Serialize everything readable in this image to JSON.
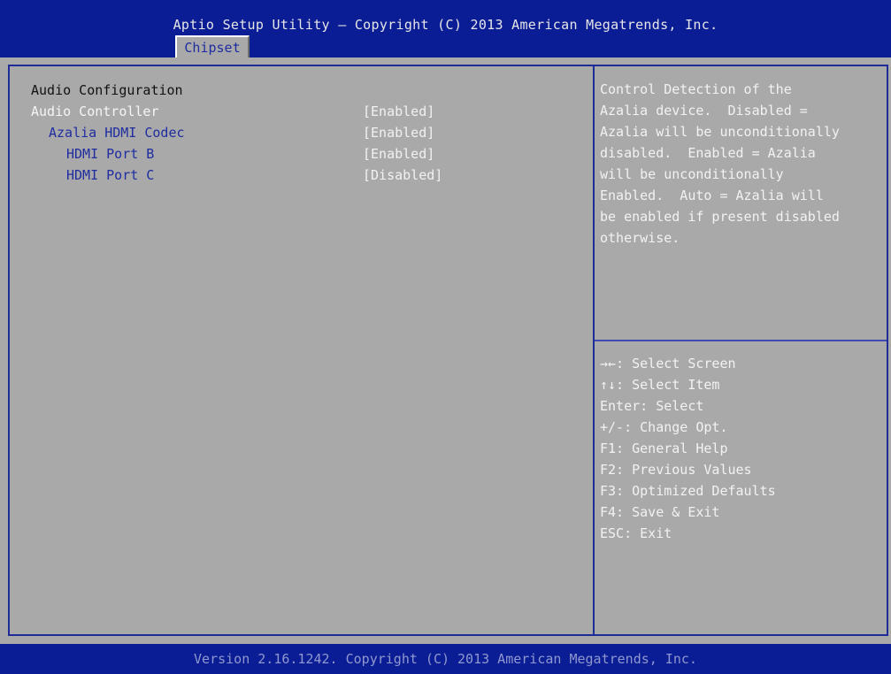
{
  "header": {
    "title": "Aptio Setup Utility – Copyright (C) 2013 American Megatrends, Inc.",
    "active_tab": "Chipset"
  },
  "main": {
    "section_title": "Audio Configuration",
    "items": [
      {
        "label": "Audio Controller",
        "value": "[Enabled]"
      },
      {
        "label": "Azalia HDMI Codec",
        "value": "[Enabled]"
      },
      {
        "label": "HDMI Port B",
        "value": "[Enabled]"
      },
      {
        "label": "HDMI Port C",
        "value": "[Disabled]"
      }
    ]
  },
  "help": {
    "lines": [
      "Control Detection of the",
      "Azalia device.  Disabled =",
      "Azalia will be unconditionally",
      "disabled.  Enabled = Azalia",
      "will be unconditionally",
      "Enabled.  Auto = Azalia will",
      "be enabled if present disabled",
      "otherwise."
    ]
  },
  "keys": [
    "→←: Select Screen",
    "↑↓: Select Item",
    "Enter: Select",
    "+/-: Change Opt.",
    "F1: General Help",
    "F2: Previous Values",
    "F3: Optimized Defaults",
    "F4: Save & Exit",
    "ESC: Exit"
  ],
  "footer": {
    "text": "Version 2.16.1242. Copyright (C) 2013 American Megatrends, Inc."
  }
}
